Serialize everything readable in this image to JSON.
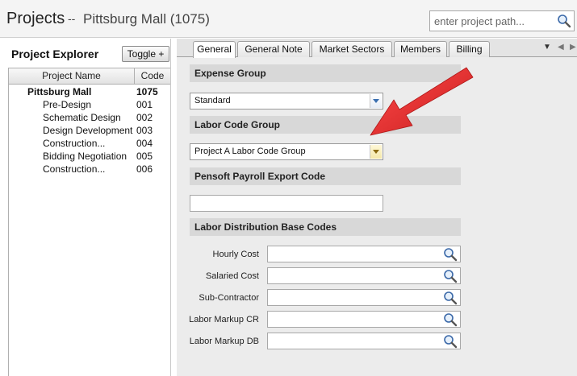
{
  "header": {
    "title": "Projects",
    "separator": "--",
    "project": "Pittsburg Mall",
    "project_code": "(1075)",
    "search_placeholder": "enter project path..."
  },
  "explorer": {
    "title": "Project Explorer",
    "toggle_label": "Toggle +",
    "columns": {
      "name": "Project Name",
      "code": "Code"
    },
    "root": {
      "name": "Pittsburg Mall",
      "code": "1075"
    },
    "children": [
      {
        "name": "Pre-Design",
        "code": "001"
      },
      {
        "name": "Schematic Design",
        "code": "002"
      },
      {
        "name": "Design Development",
        "code": "003"
      },
      {
        "name": "Construction...",
        "code": "004"
      },
      {
        "name": "Bidding Negotiation",
        "code": "005"
      },
      {
        "name": "Construction...",
        "code": "006"
      }
    ]
  },
  "tabs": [
    "General",
    "General Note",
    "Market Sectors",
    "Members",
    "Billing"
  ],
  "form": {
    "expense_group_title": "Expense Group",
    "expense_group_value": "Standard",
    "labor_code_group_title": "Labor Code Group",
    "labor_code_group_value": "Project A Labor Code Group",
    "pensoft_title": "Pensoft Payroll Export Code",
    "pensoft_value": "",
    "labor_dist_title": "Labor Distribution Base Codes",
    "fields": [
      {
        "label": "Hourly Cost",
        "value": ""
      },
      {
        "label": "Salaried Cost",
        "value": ""
      },
      {
        "label": "Sub-Contractor",
        "value": ""
      },
      {
        "label": "Labor Markup CR",
        "value": ""
      },
      {
        "label": "Labor Markup DB",
        "value": ""
      }
    ]
  },
  "icons": {
    "search": "magnifier-icon",
    "annotation": "red-arrow-icon",
    "tab_menu": "triangle-down-icon",
    "tab_prev": "triangle-left-icon",
    "tab_next": "triangle-right-icon"
  },
  "colors": {
    "annotation_arrow": "#e8262b",
    "section_header": "#d8d8d8"
  }
}
